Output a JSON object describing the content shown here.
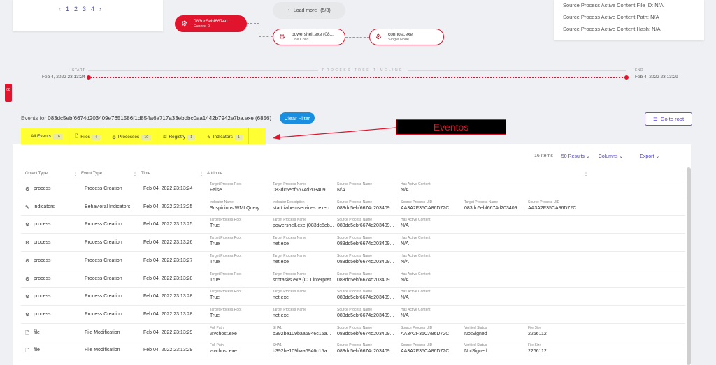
{
  "pager": {
    "prev": "‹",
    "pages": [
      "1",
      "2",
      "3",
      "4"
    ],
    "next": "›"
  },
  "tree": {
    "load_more": "Load more",
    "load_more_count": "(5/8)",
    "main_node": {
      "title": "083dc5ebf6674d...",
      "sub": "Events: 9"
    },
    "ps_node": {
      "title": "powershell.exe (08...",
      "sub": "One Child"
    },
    "ch_node": {
      "title": "conhost.exe",
      "sub": "Single Node"
    }
  },
  "right_panel": [
    "Source Process Active Content File ID: N/A",
    "Source Process Active Content Path: N/A",
    "Source Process Active Content Hash: N/A"
  ],
  "timeline": {
    "title": "PROCESS TREE TIMELINE",
    "start_label": "START",
    "start_date": "Feb 4, 2022 23:13:24",
    "end_label": "END",
    "end_date": "Feb 4, 2022 23:13:29"
  },
  "side_tag": "08",
  "events": {
    "prefix": "Events for ",
    "name": "083dc5ebf6674d203409e7651586f1d854a6a717a33ebdbc0aa1442b7942e7ba.exe (6856)",
    "clear_filter": "Clear Filter",
    "go_to_root": "Go to root"
  },
  "tabs": [
    {
      "label": "All Events",
      "count": "16",
      "icon": ""
    },
    {
      "label": "Files",
      "count": "4",
      "icon": "file-icon"
    },
    {
      "label": "Processes",
      "count": "10",
      "icon": "gear-icon"
    },
    {
      "label": "Registry",
      "count": "1",
      "icon": "key-icon"
    },
    {
      "label": "Indicators",
      "count": "1",
      "icon": "pin-icon"
    }
  ],
  "callout": "Eventos",
  "toolbar": {
    "items": "16 Items",
    "results": "50 Results",
    "columns": "Columns",
    "export": "Export"
  },
  "columns": [
    "Object Type",
    "Event Type",
    "Time",
    "Attribute"
  ],
  "rows": [
    {
      "obj": "process",
      "icon": "gear-icon",
      "event": "Process Creation",
      "time": "Feb 04, 2022 23:13:24",
      "attrs": [
        [
          "Target Process Root",
          "False"
        ],
        [
          "Target Process Name",
          "083dc5ebf6674d203409..."
        ],
        [
          "Source Process Name",
          "N/A"
        ],
        [
          "Has Active Content",
          "N/A"
        ]
      ]
    },
    {
      "obj": "indicators",
      "icon": "pin-icon",
      "event": "Behavioral Indicators",
      "time": "Feb 04, 2022 23:13:25",
      "attrs": [
        [
          "Indicator Name",
          "Suspicious WMI Query"
        ],
        [
          "Indicator Description",
          "start iwbemservices::exec..."
        ],
        [
          "Source Process Name",
          "083dc5ebf6674d203409..."
        ],
        [
          "Source Process UID",
          "AA3A2F35CA86D72C"
        ],
        [
          "Target Process Name",
          "083dc5ebf6674d203409..."
        ],
        [
          "Source Process UID",
          "AA3A2F35CA86D72C"
        ]
      ]
    },
    {
      "obj": "process",
      "icon": "gear-icon",
      "event": "Process Creation",
      "time": "Feb 04, 2022 23:13:25",
      "attrs": [
        [
          "Target Process Root",
          "True"
        ],
        [
          "Target Process Name",
          "powershell.exe (083dc5eb..."
        ],
        [
          "Source Process Name",
          "083dc5ebf6674d203409..."
        ],
        [
          "Has Active Content",
          "N/A"
        ]
      ]
    },
    {
      "obj": "process",
      "icon": "gear-icon",
      "event": "Process Creation",
      "time": "Feb 04, 2022 23:13:26",
      "attrs": [
        [
          "Target Process Root",
          "True"
        ],
        [
          "Target Process Name",
          "net.exe"
        ],
        [
          "Source Process Name",
          "083dc5ebf6674d203409..."
        ],
        [
          "Has Active Content",
          "N/A"
        ]
      ]
    },
    {
      "obj": "process",
      "icon": "gear-icon",
      "event": "Process Creation",
      "time": "Feb 04, 2022 23:13:27",
      "attrs": [
        [
          "Target Process Root",
          "True"
        ],
        [
          "Target Process Name",
          "net.exe"
        ],
        [
          "Source Process Name",
          "083dc5ebf6674d203409..."
        ],
        [
          "Has Active Content",
          "N/A"
        ]
      ]
    },
    {
      "obj": "process",
      "icon": "gear-icon",
      "event": "Process Creation",
      "time": "Feb 04, 2022 23:13:28",
      "attrs": [
        [
          "Target Process Root",
          "True"
        ],
        [
          "Target Process Name",
          "schtasks.exe (CLI interpret..."
        ],
        [
          "Source Process Name",
          "083dc5ebf6674d203409..."
        ],
        [
          "Has Active Content",
          "N/A"
        ]
      ]
    },
    {
      "obj": "process",
      "icon": "gear-icon",
      "event": "Process Creation",
      "time": "Feb 04, 2022 23:13:28",
      "attrs": [
        [
          "Target Process Root",
          "True"
        ],
        [
          "Target Process Name",
          "net.exe"
        ],
        [
          "Source Process Name",
          "083dc5ebf6674d203409..."
        ],
        [
          "Has Active Content",
          "N/A"
        ]
      ]
    },
    {
      "obj": "process",
      "icon": "gear-icon",
      "event": "Process Creation",
      "time": "Feb 04, 2022 23:13:28",
      "attrs": [
        [
          "Target Process Root",
          "True"
        ],
        [
          "Target Process Name",
          "net.exe"
        ],
        [
          "Source Process Name",
          "083dc5ebf6674d203409..."
        ],
        [
          "Has Active Content",
          "N/A"
        ]
      ]
    },
    {
      "obj": "file",
      "icon": "file-icon",
      "event": "File Modification",
      "time": "Feb 04, 2022 23:13:29",
      "attrs": [
        [
          "Full Path",
          "\\svchost.exe"
        ],
        [
          "SHA1",
          "b392be109baa6946c15a..."
        ],
        [
          "Source Process Name",
          "083dc5ebf6674d203409..."
        ],
        [
          "Source Process UID",
          "AA3A2F35CA86D72C"
        ],
        [
          "Verified Status",
          "NotSigned"
        ],
        [
          "File Size",
          "2266112"
        ]
      ]
    },
    {
      "obj": "file",
      "icon": "file-icon",
      "event": "File Modification",
      "time": "Feb 04, 2022 23:13:29",
      "attrs": [
        [
          "Full Path",
          "\\svchost.exe"
        ],
        [
          "SHA1",
          "b392be109baa6946c15a..."
        ],
        [
          "Source Process Name",
          "083dc5ebf6674d203409..."
        ],
        [
          "Source Process UID",
          "AA3A2F35CA86D72C"
        ],
        [
          "Verified Status",
          "NotSigned"
        ],
        [
          "File Size",
          "2266112"
        ]
      ]
    }
  ],
  "colors": {
    "accent_red": "#e0142c",
    "highlight": "#ffff33",
    "blue": "#1a8fe0",
    "purple": "#5a3fd0"
  }
}
